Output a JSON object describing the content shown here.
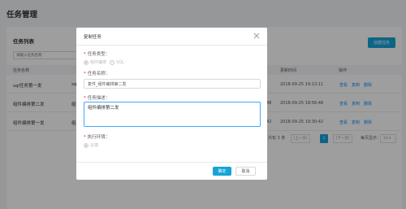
{
  "page": {
    "title": "任务管理"
  },
  "panel": {
    "title": "任务列表",
    "create_button": "创建任务",
    "search_placeholder": "请输入任务名称"
  },
  "table": {
    "headers": [
      "任务名称",
      "更新时间",
      "操作"
    ],
    "rows": [
      {
        "name": "sql任务第一发",
        "mid": "sq",
        "extra": "",
        "time": "2018-09-25 19:13:11"
      },
      {
        "name": "组件编排第二发",
        "mid": "组",
        "extra": "48",
        "time": "2018-09-25 18:56:48"
      },
      {
        "name": "组件编排第一发",
        "mid": "组",
        "extra": "42",
        "time": "2018-09-25 19:30:42"
      }
    ],
    "ops": [
      "查看",
      "复制",
      "删除"
    ]
  },
  "pager": {
    "total": "共有 3 条",
    "prev": "上一页",
    "current": "1",
    "next": "下一页",
    "per_page_label": "每页显示：",
    "per_page": "10"
  },
  "modal": {
    "title": "复制任务",
    "type_label": "任务类型：",
    "type_options": [
      "组件编排",
      "SQL"
    ],
    "name_label": "任务名称：",
    "name_value": "复件_组件编排第二发",
    "desc_label": "任务描述：",
    "desc_value": "组件编排第二发",
    "env_label": "执行环境：",
    "env_option": "云端",
    "ok_label": "确定",
    "cancel_label": "取消"
  },
  "colors": {
    "accent": "#16a3d8",
    "link": "#1890ff",
    "required": "#f5222d"
  }
}
